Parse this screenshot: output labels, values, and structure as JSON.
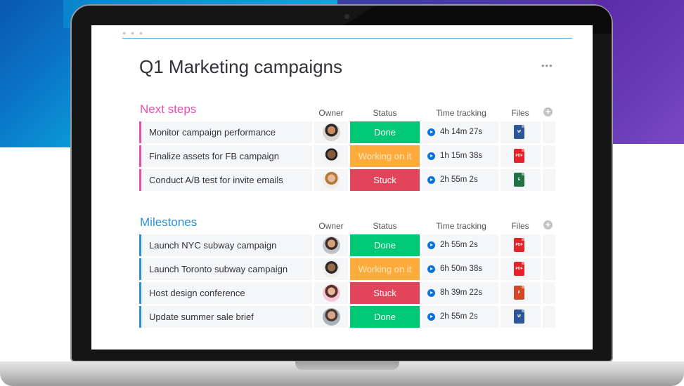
{
  "board": {
    "title": "Q1 Marketing campaigns",
    "menu_icon": "more-dots-icon",
    "window_dots": "● ● ●"
  },
  "columns": {
    "owner": "Owner",
    "status": "Status",
    "time": "Time tracking",
    "files": "Files"
  },
  "colors": {
    "next_steps": "#e44fb1",
    "milestones": "#2a92d1",
    "done": "#00c875",
    "working": "#fdab3d",
    "stuck": "#e2445c",
    "play": "#0a73d9"
  },
  "groups": [
    {
      "title": "Next steps",
      "rows": [
        {
          "name": "Monitor campaign performance",
          "owner": "avatar",
          "status": "Done",
          "time": "4h 14m 27s",
          "file": "W"
        },
        {
          "name": "Finalize assets for FB campaign",
          "owner": "avatar",
          "status": "Working on it",
          "time": "1h 15m 38s",
          "file": "PDF"
        },
        {
          "name": "Conduct A/B test for invite emails",
          "owner": "avatar",
          "status": "Stuck",
          "time": "2h 55m 2s",
          "file": "E"
        }
      ]
    },
    {
      "title": "Milestones",
      "rows": [
        {
          "name": "Launch NYC subway campaign",
          "owner": "avatar",
          "status": "Done",
          "time": "2h 55m 2s",
          "file": "PDF"
        },
        {
          "name": "Launch Toronto subway campaign",
          "owner": "avatar",
          "status": "Working on it",
          "time": "6h 50m 38s",
          "file": "PDF"
        },
        {
          "name": "Host design conference",
          "owner": "avatar",
          "status": "Stuck",
          "time": "8h 39m 22s",
          "file": "P"
        },
        {
          "name": "Update summer sale brief",
          "owner": "avatar",
          "status": "Done",
          "time": "2h 55m 2s",
          "file": "W"
        }
      ]
    }
  ]
}
